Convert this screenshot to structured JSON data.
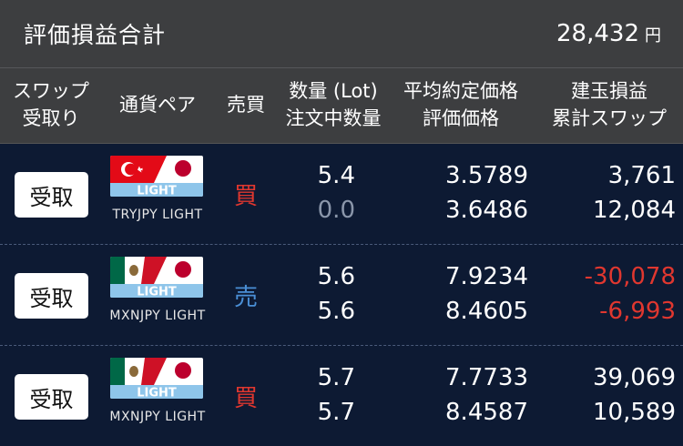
{
  "summary": {
    "label": "評価損益合計",
    "value": "28,432",
    "unit": "円"
  },
  "headers": {
    "swap": [
      "スワップ",
      "受取り"
    ],
    "pair": "通貨ペア",
    "side": "売買",
    "qty": [
      "数量 (Lot)",
      "注文中数量"
    ],
    "price": [
      "平均約定価格",
      "評価価格"
    ],
    "pl": [
      "建玉損益",
      "累計スワップ"
    ]
  },
  "colors": {
    "buy": "#e0372f",
    "sell": "#4a8fd6",
    "negative": "#e0372f"
  },
  "rows": [
    {
      "button": "受取",
      "pair": "TRYJPY LIGHT",
      "flag_label": "LIGHT",
      "flag_icon": "turkey-japan-flag-icon",
      "side": "買",
      "side_type": "buy",
      "qty": "5.4",
      "pending": "0.0",
      "avg_price": "3.5789",
      "eval_price": "3.6486",
      "pl": "3,761",
      "swap": "12,084"
    },
    {
      "button": "受取",
      "pair": "MXNJPY LIGHT",
      "flag_label": "LIGHT",
      "flag_icon": "mexico-japan-flag-icon",
      "side": "売",
      "side_type": "sell",
      "qty": "5.6",
      "pending": "5.6",
      "avg_price": "7.9234",
      "eval_price": "8.4605",
      "pl": "-30,078",
      "swap": "-6,993"
    },
    {
      "button": "受取",
      "pair": "MXNJPY LIGHT",
      "flag_label": "LIGHT",
      "flag_icon": "mexico-japan-flag-icon",
      "side": "買",
      "side_type": "buy",
      "qty": "5.7",
      "pending": "5.7",
      "avg_price": "7.7733",
      "eval_price": "8.4587",
      "pl": "39,069",
      "swap": "10,589"
    }
  ]
}
